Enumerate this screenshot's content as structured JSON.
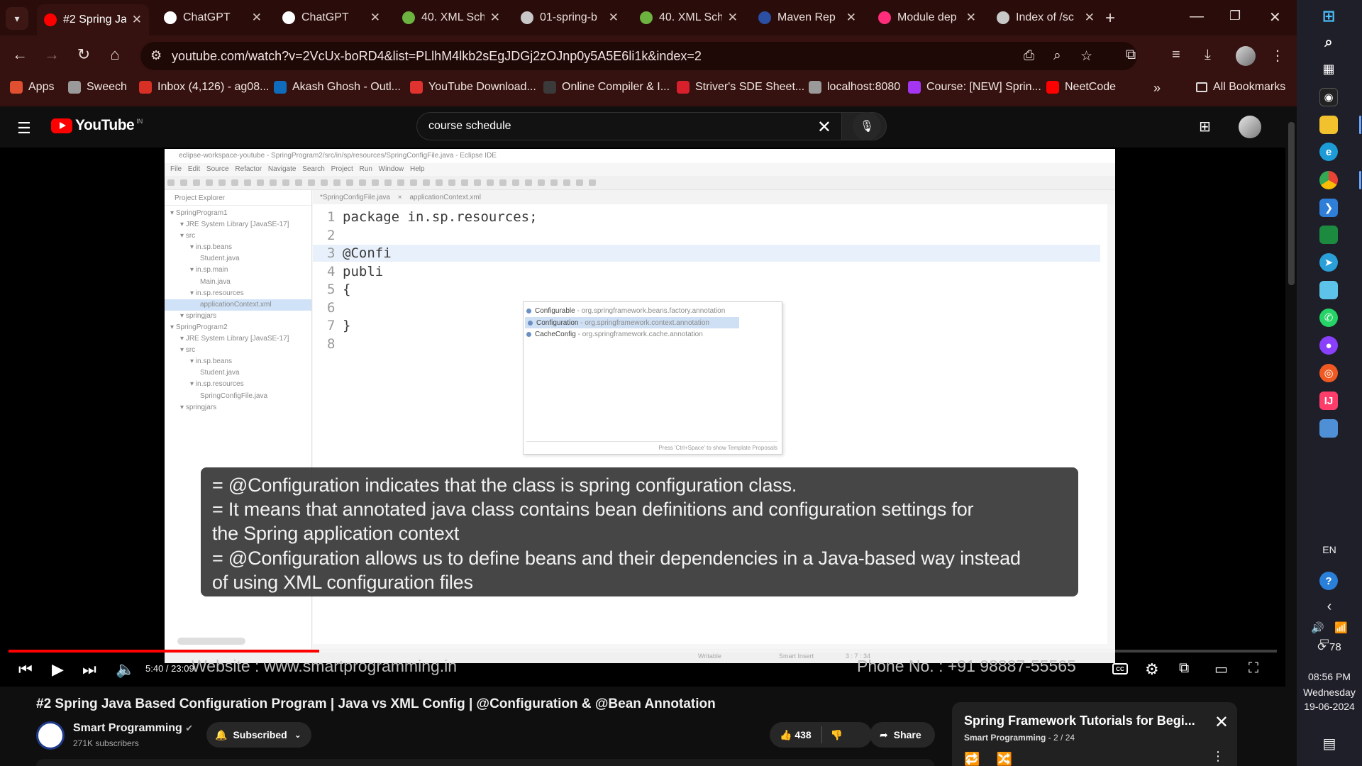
{
  "browser": {
    "tabs": [
      {
        "title": "#2 Spring Ja",
        "favicon": "youtube-icon",
        "color": "#ff0000",
        "active": true
      },
      {
        "title": "ChatGPT",
        "favicon": "chatgpt-icon",
        "color": "#ffffff"
      },
      {
        "title": "ChatGPT",
        "favicon": "chatgpt-icon",
        "color": "#ffffff"
      },
      {
        "title": "40. XML Sch",
        "favicon": "spring-icon",
        "color": "#6db33f"
      },
      {
        "title": "01-spring-b",
        "favicon": "globe-icon",
        "color": "#c8c8c8"
      },
      {
        "title": "40. XML Sch",
        "favicon": "spring-icon",
        "color": "#6db33f"
      },
      {
        "title": "Maven Rep",
        "favicon": "maven-icon",
        "color": "#2b4fa3"
      },
      {
        "title": "Module dep",
        "favicon": "module-icon",
        "color": "#ff2d7a"
      },
      {
        "title": "Index of /sc",
        "favicon": "globe-icon",
        "color": "#c8c8c8"
      }
    ],
    "url": "youtube.com/watch?v=2VcUx-boRD4&list=PLlhM4lkb2sEgJDGj2zOJnp0y5A5E6li1k&index=2",
    "bookmarks": [
      {
        "label": "Apps",
        "icon": "apps-grid-icon",
        "color": "#e04f2f"
      },
      {
        "label": "Sweech",
        "icon": "globe-icon",
        "color": "#9a9a9a"
      },
      {
        "label": "Inbox (4,126) - ag08...",
        "icon": "gmail-icon",
        "color": "#d93025"
      },
      {
        "label": "Akash Ghosh - Outl...",
        "icon": "outlook-icon",
        "color": "#0f6cbd"
      },
      {
        "label": "YouTube Download...",
        "icon": "download-icon",
        "color": "#e0332f"
      },
      {
        "label": "Online Compiler & I...",
        "icon": "compiler-icon",
        "color": "#3a3a3a"
      },
      {
        "label": "Striver's SDE Sheet...",
        "icon": "tuf-icon",
        "color": "#d8202c"
      },
      {
        "label": "localhost:8080",
        "icon": "globe-icon",
        "color": "#9a9a9a"
      },
      {
        "label": "Course: [NEW] Sprin...",
        "icon": "udemy-icon",
        "color": "#a435f0"
      },
      {
        "label": "NeetCode",
        "icon": "youtube-icon",
        "color": "#ff0000"
      }
    ],
    "all_bookmarks": "All Bookmarks"
  },
  "youtube": {
    "search_query": "course schedule",
    "logo_text": "YouTube",
    "country_code": "IN",
    "video": {
      "eclipse_title": "eclipse-workspace-youtube - SpringProgram2/src/in/sp/resources/SpringConfigFile.java - Eclipse IDE",
      "eclipse_menu": "File  Edit  Source  Refactor  Navigate  Search  Project  Run  Window  Help",
      "project_explorer": "Project Explorer",
      "tree": [
        {
          "label": "SpringProgram1",
          "indent": 0
        },
        {
          "label": "JRE System Library [JavaSE-17]",
          "indent": 1
        },
        {
          "label": "src",
          "indent": 1
        },
        {
          "label": "in.sp.beans",
          "indent": 2
        },
        {
          "label": "Student.java",
          "indent": 3
        },
        {
          "label": "in.sp.main",
          "indent": 2
        },
        {
          "label": "Main.java",
          "indent": 3
        },
        {
          "label": "in.sp.resources",
          "indent": 2
        },
        {
          "label": "applicationContext.xml",
          "indent": 3,
          "selected": true
        },
        {
          "label": "springjars",
          "indent": 1
        },
        {
          "label": "SpringProgram2",
          "indent": 0
        },
        {
          "label": "JRE System Library [JavaSE-17]",
          "indent": 1
        },
        {
          "label": "src",
          "indent": 1
        },
        {
          "label": "in.sp.beans",
          "indent": 2
        },
        {
          "label": "Student.java",
          "indent": 3
        },
        {
          "label": "in.sp.resources",
          "indent": 2
        },
        {
          "label": "SpringConfigFile.java",
          "indent": 3
        },
        {
          "label": "springjars",
          "indent": 1
        }
      ],
      "editor_tabs": "*SpringConfigFile.java ×   applicationContext.xml",
      "code_lines": [
        {
          "num": "1",
          "text": "package in.sp.resources;"
        },
        {
          "num": "2",
          "text": ""
        },
        {
          "num": "3",
          "text": "@Confi"
        },
        {
          "num": "4",
          "text": "publi"
        },
        {
          "num": "5",
          "text": "{"
        },
        {
          "num": "6",
          "text": ""
        },
        {
          "num": "7",
          "text": "}"
        },
        {
          "num": "8",
          "text": ""
        }
      ],
      "autocomplete": [
        {
          "name": "Configurable",
          "pkg": " - org.springframework.beans.factory.annotation"
        },
        {
          "name": "Configuration",
          "pkg": " - org.springframework.context.annotation",
          "highlighted": true
        },
        {
          "name": "CacheConfig",
          "pkg": " - org.springframework.cache.annotation"
        }
      ],
      "autocomplete_hint": "Press 'Ctrl+Space' to show Template Proposals",
      "status": {
        "writable": "Writable",
        "insert": "Smart Insert",
        "position": "3 : 7 : 34"
      },
      "callout_lines": [
        "= @Configuration indicates that the class is spring configuration class.",
        "= It means that annotated java class contains bean definitions and configuration settings for",
        "   the Spring application context",
        "= @Configuration allows us to define beans and their dependencies in a Java-based way instead",
        "   of using XML configuration files"
      ],
      "watermark_website": "Website : www.smartprogramming.in",
      "watermark_phone": "Phone No. : +91 98887-55565"
    },
    "player": {
      "time": "5:40 / 23:09",
      "progress": 0.245
    },
    "title": "#2 Spring Java Based Configuration Program | Java vs XML Config | @Configuration & @Bean Annotation",
    "channel": {
      "name": "Smart Programming",
      "subscribers": "271K subscribers",
      "subscribed_label": "Subscribed"
    },
    "likes": "438",
    "share_label": "Share",
    "playlist": {
      "title": "Spring Framework Tutorials for Begi...",
      "channel": "Smart Programming",
      "position": " - 2 / 24"
    }
  },
  "taskbar": {
    "language": "EN",
    "notification_count": "78",
    "time": "08:56 PM",
    "day": "Wednesday",
    "date": "19-06-2024"
  }
}
